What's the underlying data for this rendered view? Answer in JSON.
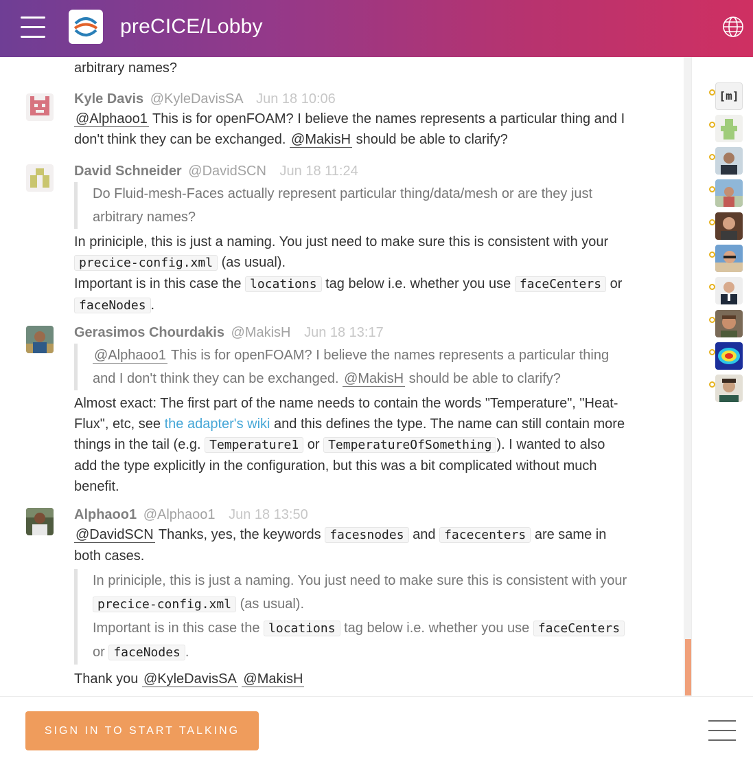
{
  "header": {
    "room_title": "preCICE/Lobby",
    "gradient_start": "#6f3e95",
    "gradient_end": "#cf3062",
    "menu_icon": "hamburger-icon",
    "language_icon": "globe-icon"
  },
  "partial_message": {
    "text": "arbitrary names?"
  },
  "messages": [
    {
      "name": "Kyle Davis",
      "handle": "@KyleDavisSA",
      "time": "Jun 18 10:06",
      "mention1": "@Alphaoo1",
      "text1": " This is for openFOAM? I believe the names represents a particular thing and I don't think they can be exchanged. ",
      "mention2": "@MakisH",
      "text2": " should be able to clarify?"
    },
    {
      "name": "David Schneider",
      "handle": "@DavidSCN",
      "time": "Jun 18 11:24",
      "quote": "Do Fluid-mesh-Faces actually represent particular thing/data/mesh or are they just arbitrary names?",
      "p1_a": "In priniciple, this is just a naming. You just need to make sure this is consistent with your ",
      "p1_code": "precice-config.xml",
      "p1_b": " (as usual).",
      "p2_a": "Important is in this case the ",
      "p2_code1": "locations",
      "p2_b": " tag below i.e. whether you use ",
      "p2_code2": "faceCenters",
      "p2_c": " or ",
      "p2_code3": "faceNodes",
      "p2_d": "."
    },
    {
      "name": "Gerasimos Chourdakis",
      "handle": "@MakisH",
      "time": "Jun 18 13:17",
      "q_mention1": "@Alphaoo1",
      "q_text1": " This is for openFOAM? I believe the names represents a particular thing and I don't think they can be exchanged. ",
      "q_mention2": "@MakisH",
      "q_text2": " should be able to clarify?",
      "t1": "Almost exact: The first part of the name needs to contain the words \"Temperature\", \"Heat-Flux\", etc, see ",
      "link": "the adapter's wiki",
      "t2": " and this defines the type. The name can still contain more things in the tail (e.g. ",
      "code1": "Temperature1",
      "t3": " or ",
      "code2": "TemperatureOfSomething",
      "t4": "). I wanted to also add the type explicitly in the configuration, but this was a bit complicated without much benefit."
    },
    {
      "name": "Alphaoo1",
      "handle": "@Alphaoo1",
      "time": "Jun 18 13:50",
      "mention": "@DavidSCN",
      "t1": " Thanks, yes, the keywords ",
      "code1": "facesnodes",
      "t2": " and ",
      "code2": "facecenters",
      "t3": " are same in both cases.",
      "q1_a": "In priniciple, this is just a naming. You just need to make sure this is consistent with your ",
      "q1_code": "precice-config.xml",
      "q1_b": " (as usual).",
      "q2_a": "Important is in this case the ",
      "q2_code1": "locations",
      "q2_b": " tag below i.e. whether you use ",
      "q2_code2": "faceCenters",
      "q2_c": " or ",
      "q2_code3": "faceNodes",
      "q2_d": ".",
      "thanks": "Thank you ",
      "thanks_m1": "@KyleDavisSA",
      "thanks_m2": "@MakisH"
    }
  ],
  "roster": {
    "first_label": "[m]",
    "status_color": "#e6b21e"
  },
  "footer": {
    "signin_label": "SIGN IN TO START TALKING",
    "signin_color": "#ef9c5c",
    "menu_icon": "menu-lines-icon"
  }
}
